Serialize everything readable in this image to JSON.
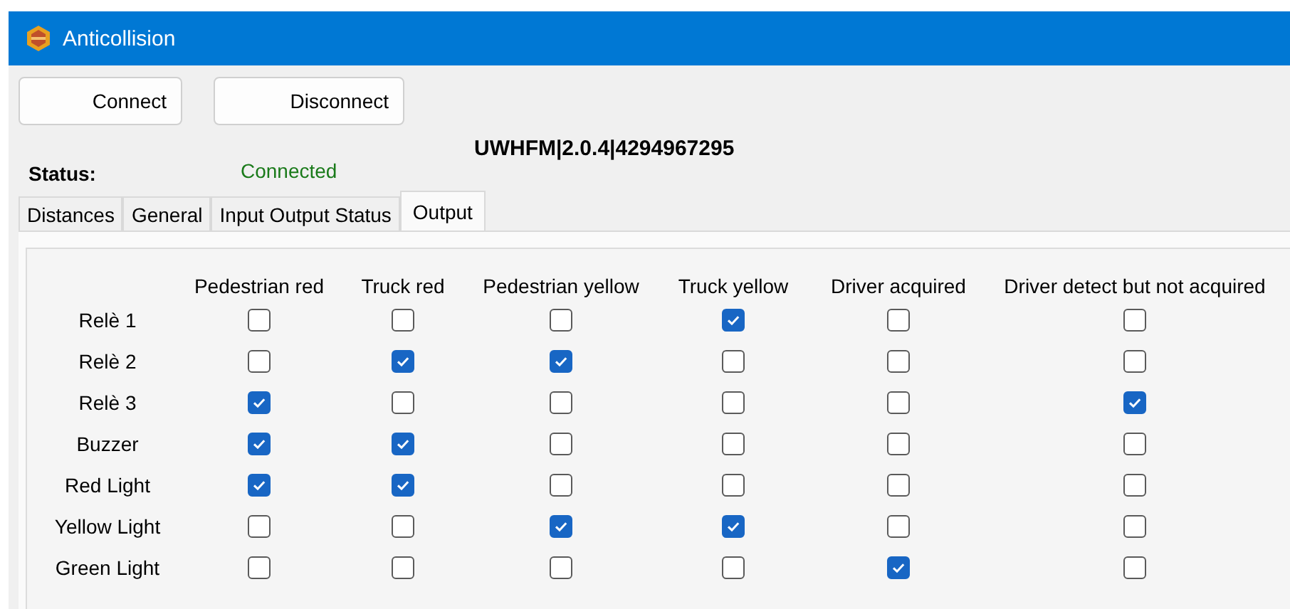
{
  "window": {
    "title": "Anticollision"
  },
  "buttons": [
    "Connect",
    "Disconnect"
  ],
  "version": "UWHFM|2.0.4|4294967295",
  "status": {
    "label": "Status:",
    "value": "Connected"
  },
  "tabs": [
    {
      "label": "Distances",
      "selected": false
    },
    {
      "label": "General",
      "selected": false
    },
    {
      "label": "Input Output Status",
      "selected": false
    },
    {
      "label": "Output",
      "selected": true
    }
  ],
  "grid": {
    "columns": [
      "Pedestrian red",
      "Truck red",
      "Pedestrian yellow",
      "Truck yellow",
      "Driver acquired",
      "Driver detect but not acquired"
    ],
    "rows": [
      {
        "label": "Relè 1",
        "checked": [
          false,
          false,
          false,
          true,
          false,
          false
        ]
      },
      {
        "label": "Relè 2",
        "checked": [
          false,
          true,
          true,
          false,
          false,
          false
        ]
      },
      {
        "label": "Relè 3",
        "checked": [
          true,
          false,
          false,
          false,
          false,
          true
        ]
      },
      {
        "label": "Buzzer",
        "checked": [
          true,
          true,
          false,
          false,
          false,
          false
        ]
      },
      {
        "label": "Red Light",
        "checked": [
          true,
          true,
          false,
          false,
          false,
          false
        ]
      },
      {
        "label": "Yellow Light",
        "checked": [
          false,
          false,
          true,
          true,
          false,
          false
        ]
      },
      {
        "label": "Green Light",
        "checked": [
          false,
          false,
          false,
          false,
          true,
          false
        ]
      }
    ]
  }
}
